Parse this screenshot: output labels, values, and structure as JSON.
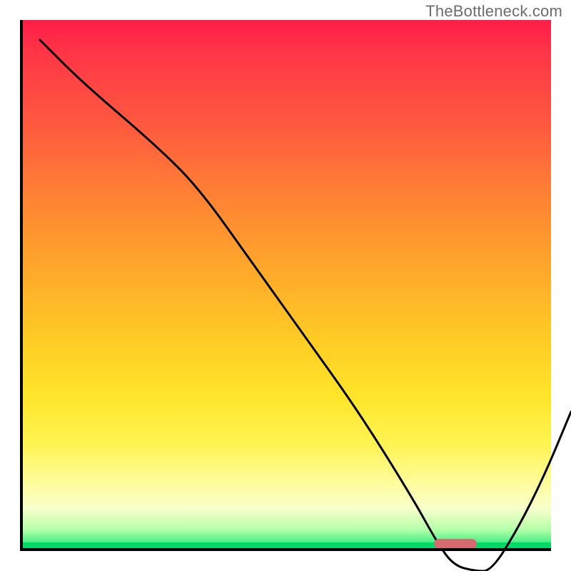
{
  "watermark": "TheBottleneck.com",
  "colors": {
    "gradient_top": "#ff1c49",
    "gradient_bottom": "#00e36d",
    "axis": "#000000",
    "curve": "#000000",
    "marker": "#d56a6f"
  },
  "chart_data": {
    "type": "line",
    "title": "",
    "xlabel": "",
    "ylabel": "",
    "xlim": [
      0,
      100
    ],
    "ylim": [
      0,
      100
    ],
    "grid": false,
    "legend": false,
    "x": [
      0,
      8,
      22,
      30,
      40,
      50,
      60,
      70,
      75,
      78,
      82,
      85,
      90,
      95,
      100
    ],
    "values": [
      100,
      92,
      80,
      72,
      58,
      44,
      30,
      14,
      5,
      1,
      0,
      0,
      8,
      18,
      30
    ],
    "marker_region": {
      "x_start": 78,
      "x_end": 86,
      "y": 1
    }
  }
}
